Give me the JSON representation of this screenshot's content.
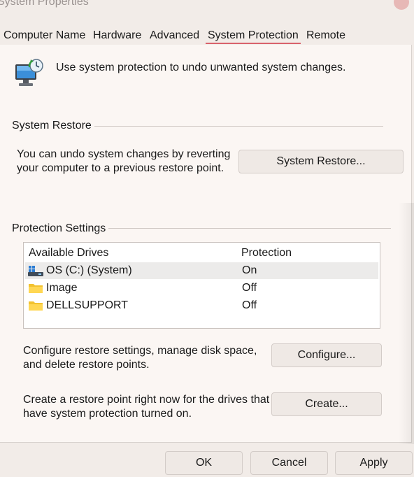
{
  "window": {
    "title": "System Properties"
  },
  "tabs": [
    {
      "label": "Computer Name"
    },
    {
      "label": "Hardware"
    },
    {
      "label": "Advanced"
    },
    {
      "label": "System Protection"
    },
    {
      "label": "Remote"
    }
  ],
  "intro": {
    "text": "Use system protection to undo unwanted system changes."
  },
  "system_restore": {
    "group_label": "System Restore",
    "description_line1": "You can undo system changes by reverting",
    "description_line2": "your computer to a previous restore point.",
    "button_label": "System Restore..."
  },
  "protection_settings": {
    "group_label": "Protection Settings",
    "columns": {
      "drives": "Available Drives",
      "protection": "Protection"
    },
    "drives": [
      {
        "name": "OS (C:) (System)",
        "protection": "On",
        "icon": "system-drive-icon"
      },
      {
        "name": "Image",
        "protection": "Off",
        "icon": "folder-drive-icon"
      },
      {
        "name": "DELLSUPPORT",
        "protection": "Off",
        "icon": "folder-drive-icon"
      }
    ],
    "configure_line1": "Configure restore settings, manage disk space,",
    "configure_line2": "and delete restore points.",
    "configure_button": "Configure...",
    "create_line1": "Create a restore point right now for the drives that",
    "create_line2": "have system protection turned on.",
    "create_button": "Create..."
  },
  "footer": {
    "ok": "OK",
    "cancel": "Cancel",
    "apply": "Apply"
  },
  "colors": {
    "accent": "#d9626b",
    "background": "#f2ece8",
    "panel": "#fbf6f3"
  }
}
